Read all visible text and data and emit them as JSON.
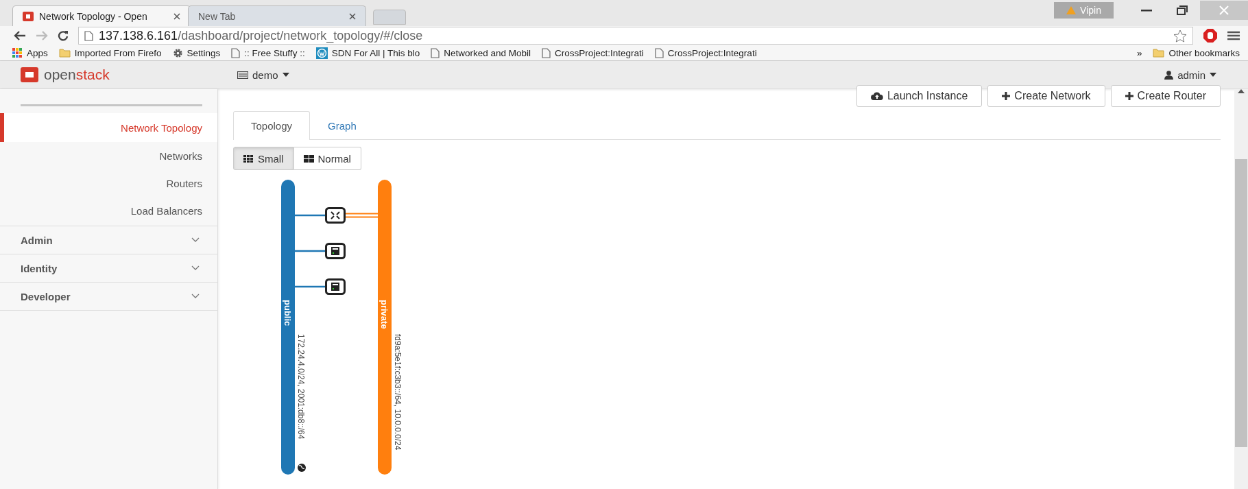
{
  "browser": {
    "tabs": [
      {
        "title": "Network Topology - Open",
        "selected": true
      },
      {
        "title": "New Tab",
        "selected": false
      }
    ],
    "profile": "Vipin",
    "url": {
      "host": "137.138.6.161",
      "path": "/dashboard/project/network_topology/#/close"
    },
    "bookmarks": [
      {
        "kind": "apps",
        "label": "Apps"
      },
      {
        "kind": "folder",
        "label": "Imported From Firefo"
      },
      {
        "kind": "gear",
        "label": "Settings"
      },
      {
        "kind": "page",
        "label": ":: Free Stuffy ::"
      },
      {
        "kind": "wordpress",
        "label": "SDN For All | This blo"
      },
      {
        "kind": "page",
        "label": "Networked and Mobil"
      },
      {
        "kind": "page",
        "label": "CrossProject:Integrati"
      },
      {
        "kind": "page",
        "label": "CrossProject:Integrati"
      }
    ],
    "overflow": "»",
    "other_bookmarks": "Other bookmarks"
  },
  "header": {
    "logo": {
      "prefix": "open",
      "suffix": "stack"
    },
    "project": "demo",
    "user": "admin"
  },
  "sidebar": {
    "items": [
      {
        "label": "Network Topology",
        "selected": true
      },
      {
        "label": "Networks",
        "selected": false
      },
      {
        "label": "Routers",
        "selected": false
      },
      {
        "label": "Load Balancers",
        "selected": false
      }
    ],
    "sections": [
      {
        "label": "Admin",
        "expanded": false
      },
      {
        "label": "Identity",
        "expanded": false
      },
      {
        "label": "Developer",
        "expanded": false
      }
    ]
  },
  "actions": [
    {
      "kind": "cloud",
      "label": "Launch Instance"
    },
    {
      "kind": "plus",
      "label": "Create Network"
    },
    {
      "kind": "plus",
      "label": "Create Router"
    }
  ],
  "tabs": [
    {
      "label": "Topology",
      "selected": true
    },
    {
      "label": "Graph",
      "selected": false
    }
  ],
  "view_toggle": [
    {
      "kind": "small",
      "label": "Small",
      "selected": true
    },
    {
      "kind": "normal",
      "label": "Normal",
      "selected": false
    }
  ],
  "topology": {
    "networks": [
      {
        "name": "public",
        "subnet": "172.24.4.0/24, 2001:db8::/64",
        "color": "#1f77b4",
        "external": true
      },
      {
        "name": "private",
        "subnet": "fd9a:5e1f:c3b3::/64, 10.0.0.0/24",
        "color": "#ff7f0e",
        "external": false
      }
    ],
    "devices": [
      {
        "kind": "router"
      },
      {
        "kind": "instance"
      },
      {
        "kind": "instance"
      }
    ]
  }
}
